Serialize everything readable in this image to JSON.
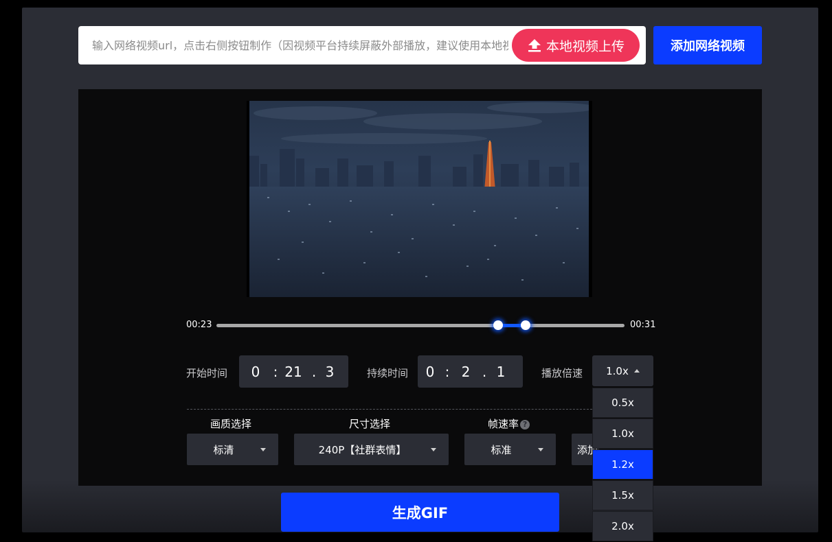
{
  "url_input": {
    "placeholder": "输入网络视频url，点击右侧按钮制作（因视频平台持续屏蔽外部播放，建议使用本地视频上传）"
  },
  "upload_button": {
    "label": "本地视频上传",
    "icon": "upload-icon"
  },
  "add_button": {
    "label": "添加网络视频"
  },
  "video": {
    "description_icon": "video-preview"
  },
  "timeline": {
    "start_label": "00:23",
    "end_label": "00:31",
    "selection_start_fraction": 0.69,
    "selection_end_fraction": 0.75
  },
  "start_time": {
    "label": "开始时间",
    "min": "0",
    "sec": "21",
    "tenth": "3",
    "sep1": ":",
    "sep2": "."
  },
  "duration": {
    "label": "持续时间",
    "min": "0",
    "sec": "2",
    "tenth": "1",
    "sep1": ":",
    "sep2": "."
  },
  "speed": {
    "label": "播放倍速",
    "selected": "1.0x",
    "options": [
      "0.5x",
      "1.0x",
      "1.2x",
      "1.5x",
      "2.0x"
    ],
    "highlighted": "1.2x"
  },
  "quality": {
    "label": "画质选择",
    "value": "标清"
  },
  "size": {
    "label": "尺寸选择",
    "value": "240P【社群表情】"
  },
  "framerate": {
    "label": "帧速率",
    "value": "标准",
    "help": "?"
  },
  "extra": {
    "value": "添加"
  },
  "generate_button": {
    "label": "生成GIF"
  },
  "colors": {
    "accent_blue": "#0b3cff",
    "upload_red": "#ef3559",
    "panel": "#2b2d35",
    "stage": "#0a0a0b"
  }
}
